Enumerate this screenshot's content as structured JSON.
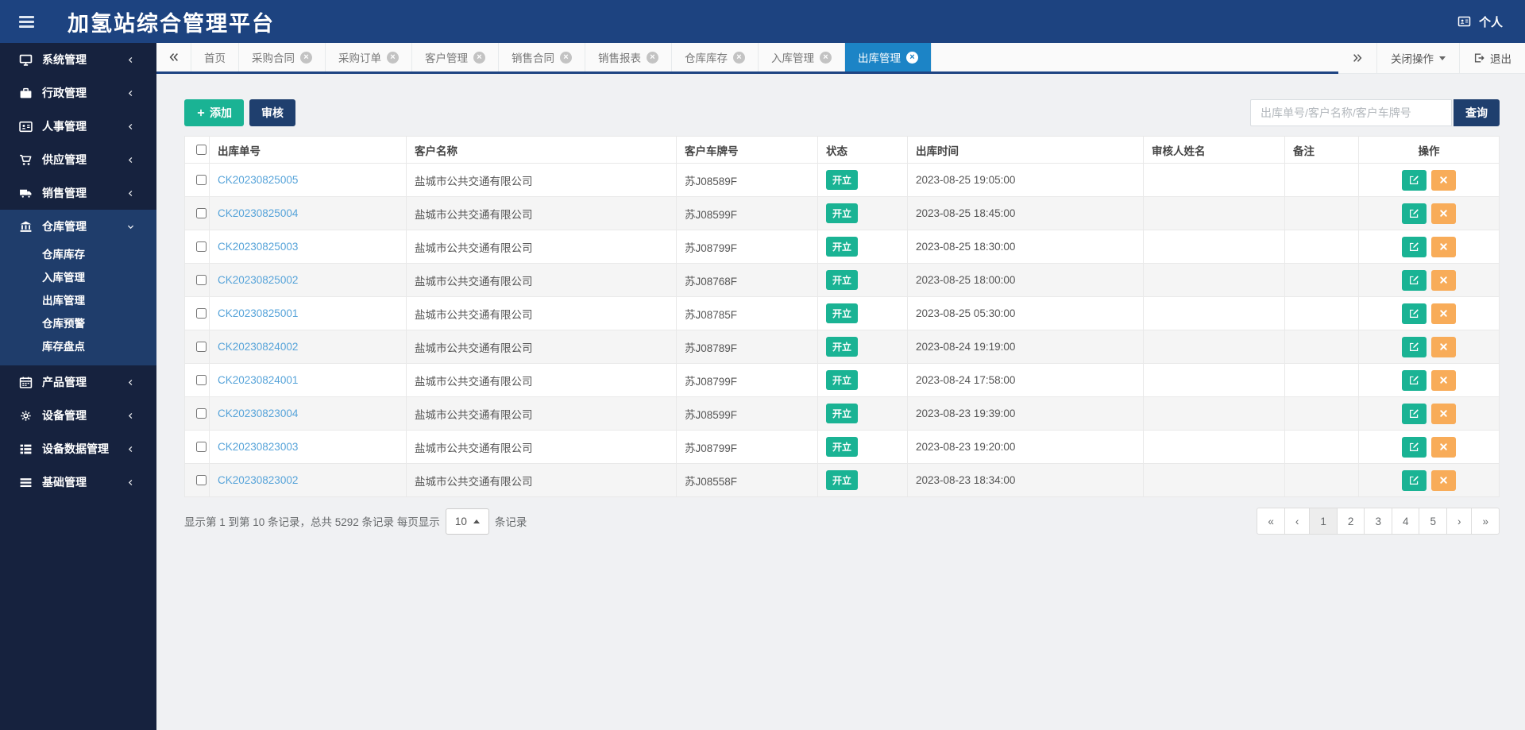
{
  "header": {
    "title": "加氢站综合管理平台",
    "user_label": "个人"
  },
  "sidebar": {
    "items": [
      {
        "label": "系统管理",
        "icon": "desktop-icon",
        "expanded": false
      },
      {
        "label": "行政管理",
        "icon": "briefcase-icon",
        "expanded": false
      },
      {
        "label": "人事管理",
        "icon": "id-card-icon",
        "expanded": false
      },
      {
        "label": "供应管理",
        "icon": "cart-icon",
        "expanded": false
      },
      {
        "label": "销售管理",
        "icon": "truck-icon",
        "expanded": false
      },
      {
        "label": "仓库管理",
        "icon": "bank-icon",
        "expanded": true,
        "children": [
          "仓库库存",
          "入库管理",
          "出库管理",
          "仓库预警",
          "库存盘点"
        ]
      },
      {
        "label": "产品管理",
        "icon": "calendar-icon",
        "expanded": false
      },
      {
        "label": "设备管理",
        "icon": "cogs-icon",
        "expanded": false
      },
      {
        "label": "设备数据管理",
        "icon": "th-list-icon",
        "expanded": false
      },
      {
        "label": "基础管理",
        "icon": "list-icon",
        "expanded": false
      }
    ]
  },
  "tabbar": {
    "tabs": [
      {
        "label": "首页",
        "closable": false,
        "active": false
      },
      {
        "label": "采购合同",
        "closable": true,
        "active": false
      },
      {
        "label": "采购订单",
        "closable": true,
        "active": false
      },
      {
        "label": "客户管理",
        "closable": true,
        "active": false
      },
      {
        "label": "销售合同",
        "closable": true,
        "active": false
      },
      {
        "label": "销售报表",
        "closable": true,
        "active": false
      },
      {
        "label": "仓库库存",
        "closable": true,
        "active": false
      },
      {
        "label": "入库管理",
        "closable": true,
        "active": false
      },
      {
        "label": "出库管理",
        "closable": true,
        "active": true
      }
    ],
    "close_actions_label": "关闭操作",
    "logout_label": "退出"
  },
  "toolbar": {
    "add_label": "添加",
    "audit_label": "审核",
    "search_placeholder": "出库单号/客户名称/客户车牌号",
    "search_value": "",
    "query_label": "查询"
  },
  "table": {
    "columns": [
      "出库单号",
      "客户名称",
      "客户车牌号",
      "状态",
      "出库时间",
      "审核人姓名",
      "备注",
      "操作"
    ],
    "rows": [
      {
        "order_no": "CK20230825005",
        "customer": "盐城市公共交通有限公司",
        "plate": "苏J08589F",
        "status": "开立",
        "time": "2023-08-25 19:05:00",
        "auditor": "",
        "remark": ""
      },
      {
        "order_no": "CK20230825004",
        "customer": "盐城市公共交通有限公司",
        "plate": "苏J08599F",
        "status": "开立",
        "time": "2023-08-25 18:45:00",
        "auditor": "",
        "remark": ""
      },
      {
        "order_no": "CK20230825003",
        "customer": "盐城市公共交通有限公司",
        "plate": "苏J08799F",
        "status": "开立",
        "time": "2023-08-25 18:30:00",
        "auditor": "",
        "remark": ""
      },
      {
        "order_no": "CK20230825002",
        "customer": "盐城市公共交通有限公司",
        "plate": "苏J08768F",
        "status": "开立",
        "time": "2023-08-25 18:00:00",
        "auditor": "",
        "remark": ""
      },
      {
        "order_no": "CK20230825001",
        "customer": "盐城市公共交通有限公司",
        "plate": "苏J08785F",
        "status": "开立",
        "time": "2023-08-25 05:30:00",
        "auditor": "",
        "remark": ""
      },
      {
        "order_no": "CK20230824002",
        "customer": "盐城市公共交通有限公司",
        "plate": "苏J08789F",
        "status": "开立",
        "time": "2023-08-24 19:19:00",
        "auditor": "",
        "remark": ""
      },
      {
        "order_no": "CK20230824001",
        "customer": "盐城市公共交通有限公司",
        "plate": "苏J08799F",
        "status": "开立",
        "time": "2023-08-24 17:58:00",
        "auditor": "",
        "remark": ""
      },
      {
        "order_no": "CK20230823004",
        "customer": "盐城市公共交通有限公司",
        "plate": "苏J08599F",
        "status": "开立",
        "time": "2023-08-23 19:39:00",
        "auditor": "",
        "remark": ""
      },
      {
        "order_no": "CK20230823003",
        "customer": "盐城市公共交通有限公司",
        "plate": "苏J08799F",
        "status": "开立",
        "time": "2023-08-23 19:20:00",
        "auditor": "",
        "remark": ""
      },
      {
        "order_no": "CK20230823002",
        "customer": "盐城市公共交通有限公司",
        "plate": "苏J08558F",
        "status": "开立",
        "time": "2023-08-23 18:34:00",
        "auditor": "",
        "remark": ""
      }
    ]
  },
  "footer": {
    "info_prefix": "显示第 1 到第 10 条记录，总共 5292 条记录 每页显示",
    "page_size": "10",
    "info_suffix": "条记录"
  },
  "pagination": {
    "items": [
      "«",
      "‹",
      "1",
      "2",
      "3",
      "4",
      "5",
      "›",
      "»"
    ],
    "active": "1"
  },
  "colors": {
    "header_bg": "#1d4380",
    "sidebar_bg": "#16223e",
    "sidebar_active_bg": "#1f3d6b",
    "active_tab_blue": "#1c84c6",
    "accent_green": "#1ab394",
    "accent_orange": "#f8ac59",
    "navy_button": "#1f3f6e",
    "link_blue": "#56a3d9"
  }
}
